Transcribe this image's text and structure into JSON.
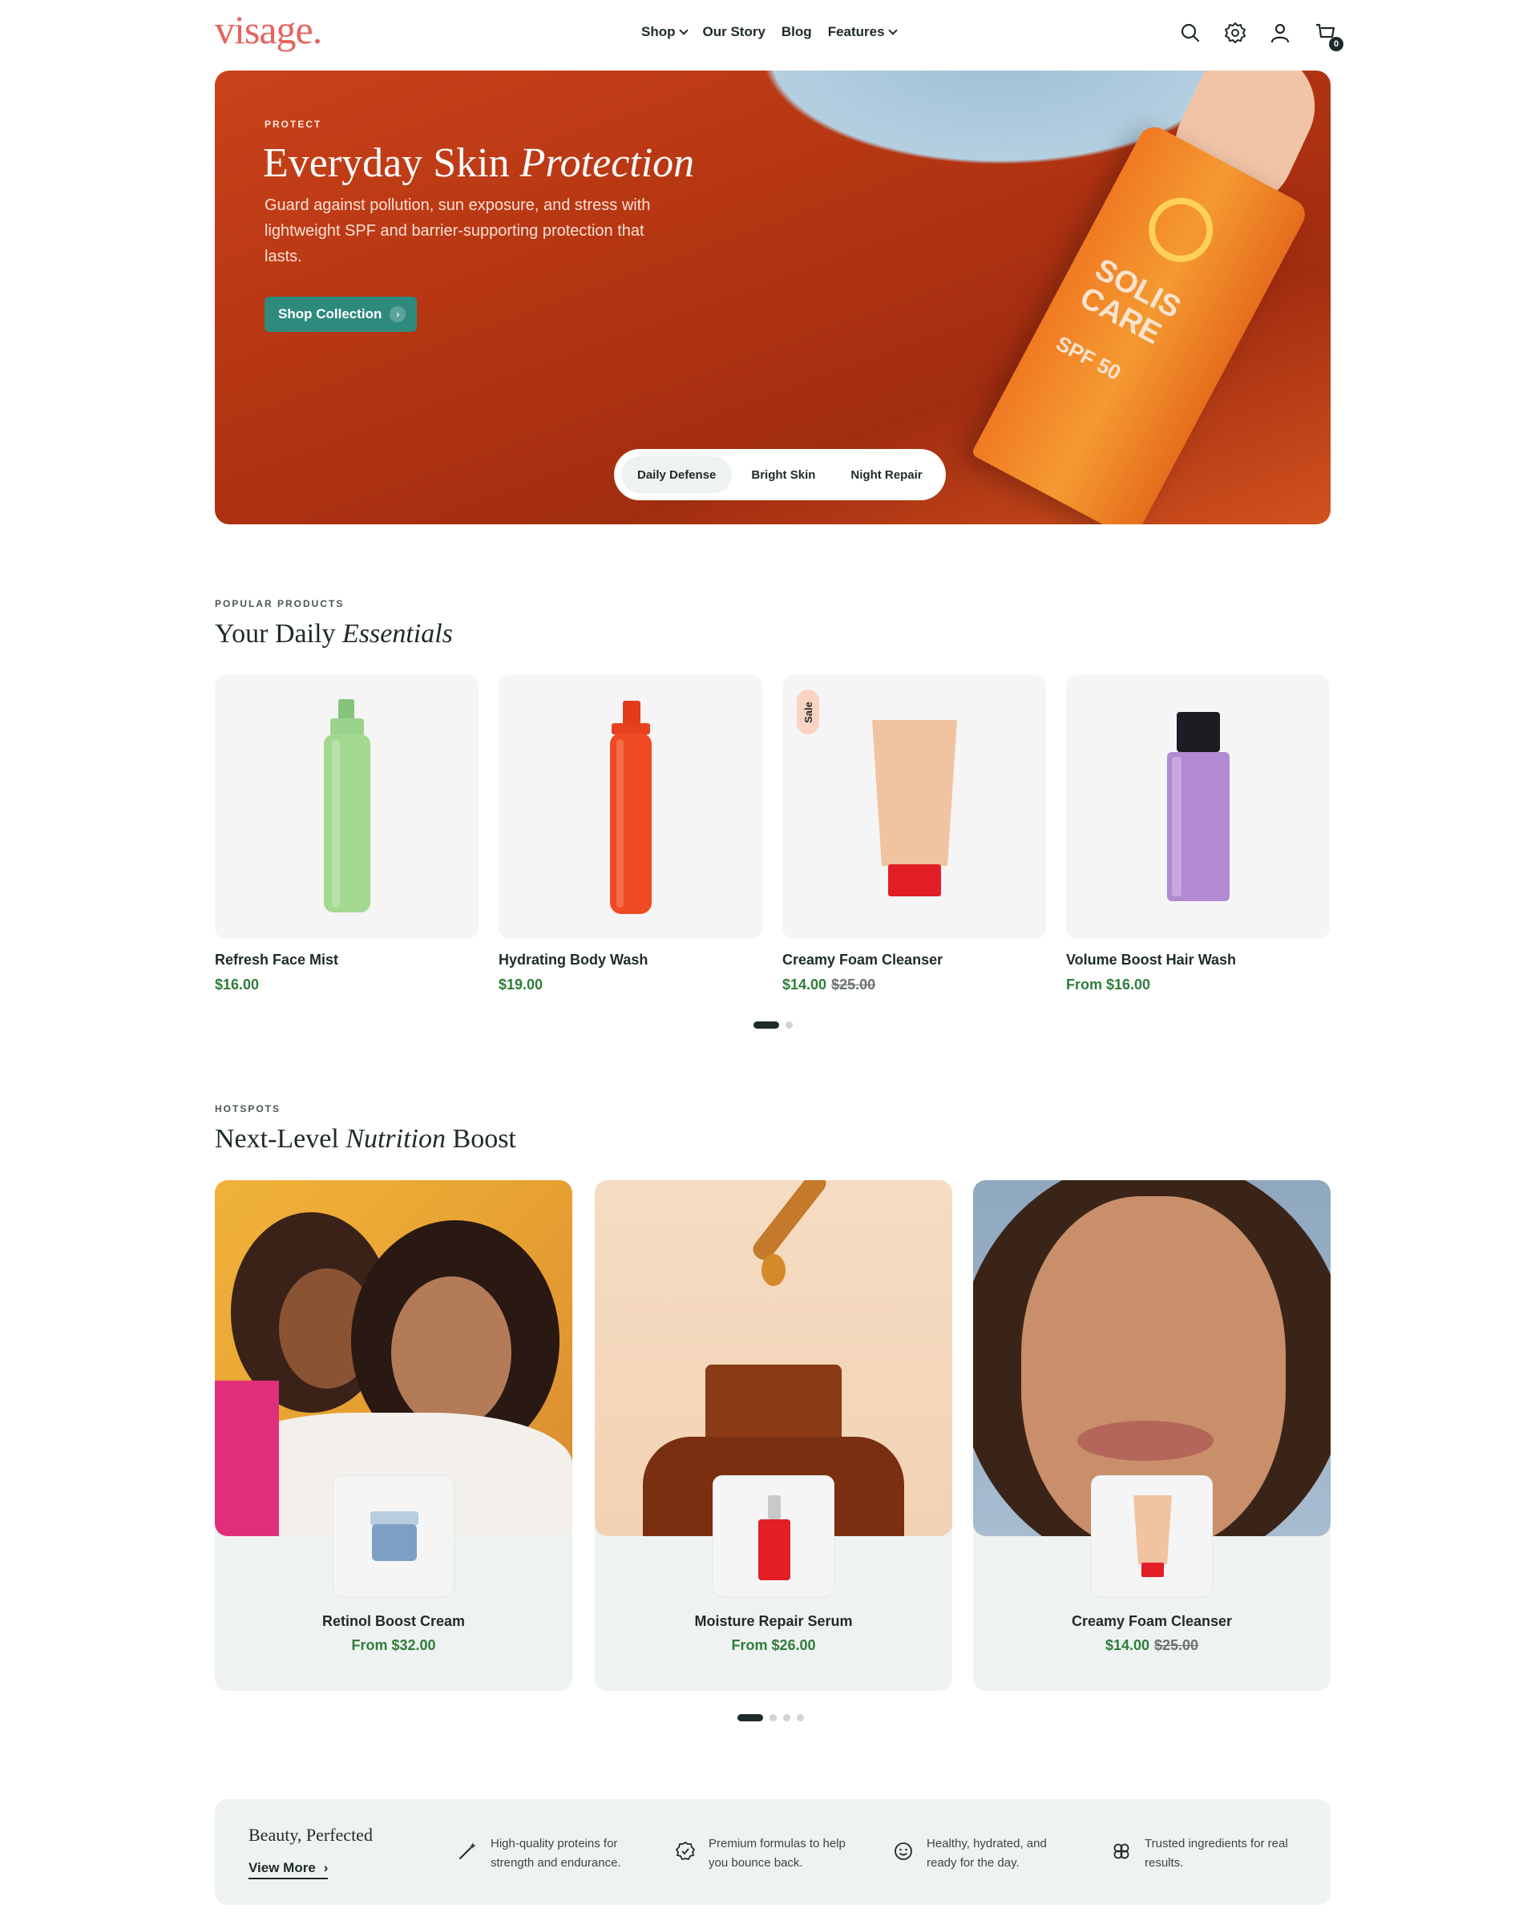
{
  "header": {
    "logo": "visage.",
    "nav": [
      {
        "label": "Shop",
        "has_dropdown": true
      },
      {
        "label": "Our Story",
        "has_dropdown": false
      },
      {
        "label": "Blog",
        "has_dropdown": false
      },
      {
        "label": "Features",
        "has_dropdown": true
      }
    ],
    "icons": [
      "search-icon",
      "settings-icon",
      "account-icon",
      "cart-icon"
    ],
    "cart_count": "0"
  },
  "hero": {
    "eyebrow": "PROTECT",
    "title_plain": "Everyday Skin",
    "title_italic": "Protection",
    "description": "Guard against pollution, sun exposure, and stress with lightweight SPF and barrier-supporting protection that lasts.",
    "button_label": "Shop Collection",
    "product_text": "SOLIS CARE",
    "product_sub": "SPF 50",
    "tabs": [
      {
        "label": "Daily Defense",
        "active": true
      },
      {
        "label": "Bright Skin",
        "active": false
      },
      {
        "label": "Night Repair",
        "active": false
      }
    ]
  },
  "popular": {
    "eyebrow": "POPULAR PRODUCTS",
    "title_plain": "Your Daily",
    "title_italic": "Essentials",
    "products": [
      {
        "name": "Refresh Face Mist",
        "price": "$16.00",
        "compare": "",
        "sale": false
      },
      {
        "name": "Hydrating Body Wash",
        "price": "$19.00",
        "compare": "",
        "sale": false
      },
      {
        "name": "Creamy Foam Cleanser",
        "price": "$14.00",
        "compare": "$25.00",
        "sale": true,
        "badge": "Sale"
      },
      {
        "name": "Volume Boost Hair Wash",
        "price": "From $16.00",
        "compare": "",
        "sale": false
      }
    ],
    "pagination": {
      "pages": 2,
      "active": 1
    }
  },
  "hotspots": {
    "eyebrow": "HOTSPOTS",
    "title_plain_1": "Next-Level",
    "title_italic": "Nutrition",
    "title_plain_2": "Boost",
    "cards": [
      {
        "name": "Retinol Boost Cream",
        "price": "From $32.00",
        "compare": ""
      },
      {
        "name": "Moisture Repair Serum",
        "price": "From $26.00",
        "compare": ""
      },
      {
        "name": "Creamy Foam Cleanser",
        "price": "$14.00",
        "compare": "$25.00"
      }
    ],
    "pagination": {
      "pages": 4,
      "active": 1
    }
  },
  "strip": {
    "title": "Beauty, Perfected",
    "link": "View More",
    "features": [
      {
        "icon": "magic-wand-icon",
        "text": "High-quality proteins for strength and endurance."
      },
      {
        "icon": "badge-check-icon",
        "text": "Premium formulas to help you bounce back."
      },
      {
        "icon": "smile-icon",
        "text": "Healthy, hydrated, and ready for the day."
      },
      {
        "icon": "clover-icon",
        "text": "Trusted ingredients for real results."
      }
    ]
  },
  "colors": {
    "brand": "#e5645e",
    "accent": "#2f8a7e",
    "price": "#2f7d3a",
    "panel": "#eef3f2"
  }
}
